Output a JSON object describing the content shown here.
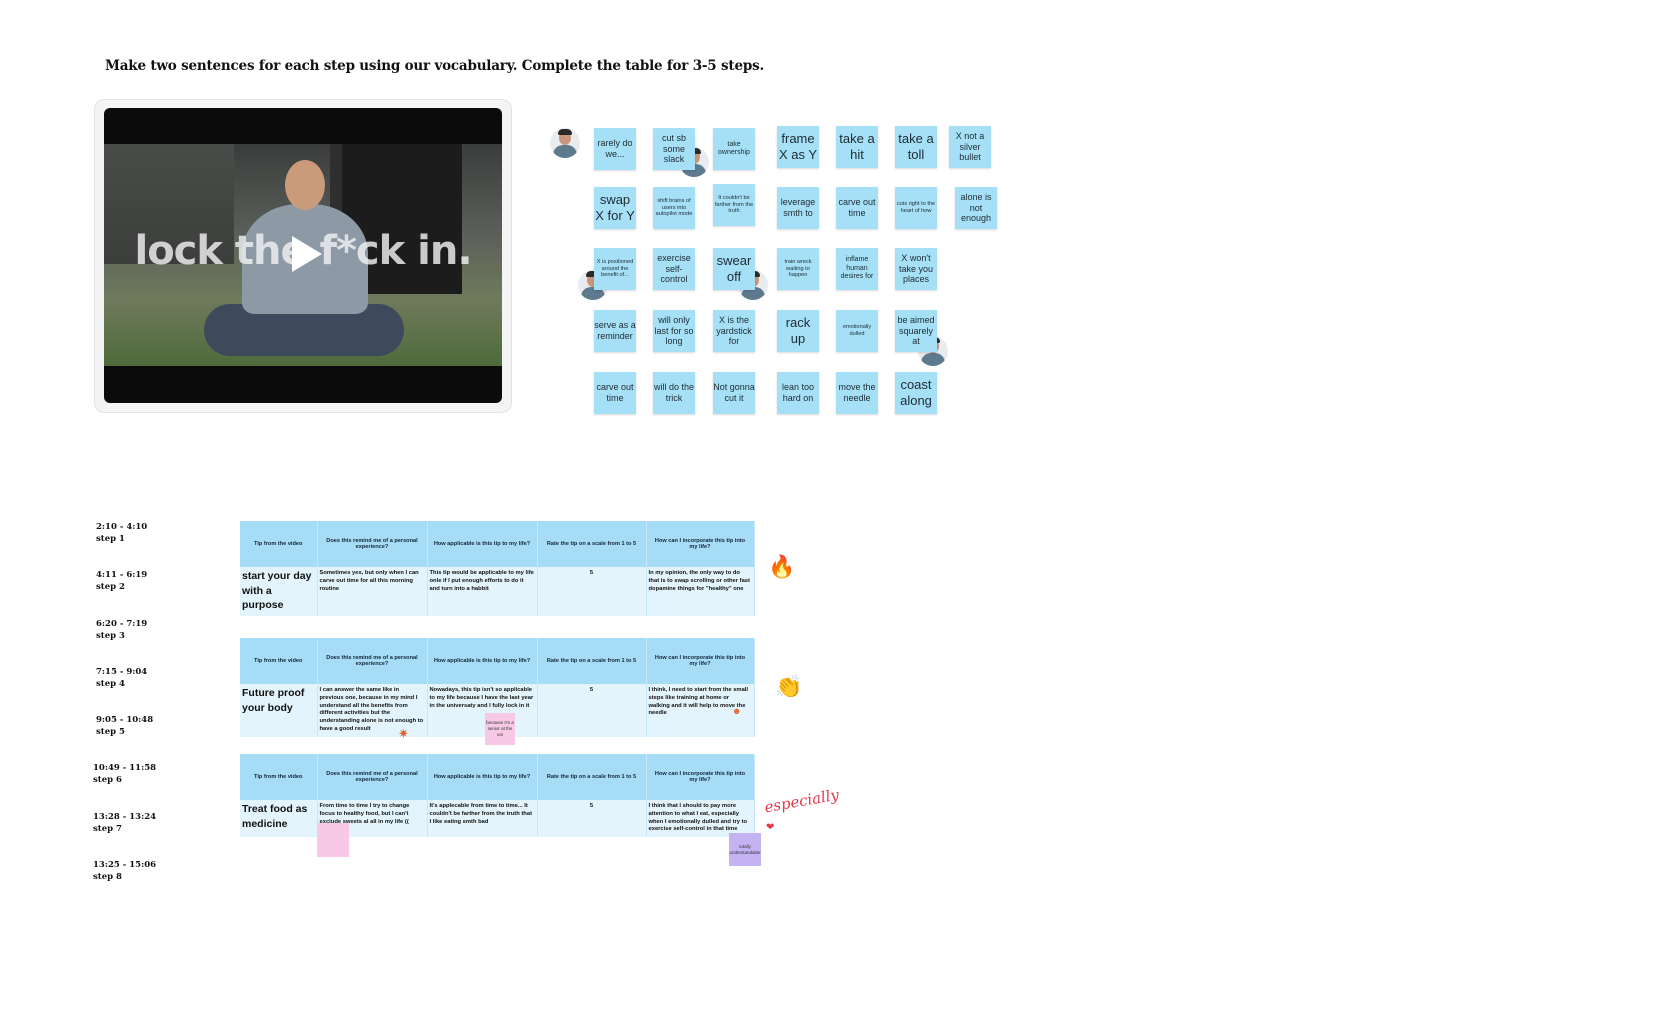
{
  "instruction": "Make two sentences for each step using our vocabulary. Complete the table for 3-5 steps.",
  "video": {
    "overlay_text": "lock th▶f*ck in.",
    "overlay_visible": "lock the f*ck in."
  },
  "stickies": [
    {
      "text": "rarely do we...",
      "size": "m"
    },
    {
      "text": "cut sb some slack",
      "size": "m"
    },
    {
      "text": "take ownership",
      "size": "s"
    },
    {
      "text": "frame X as Y",
      "size": "l"
    },
    {
      "text": "take a hit",
      "size": "l"
    },
    {
      "text": "take a toll",
      "size": "l"
    },
    {
      "text": "X not a silver bullet",
      "size": "m"
    },
    {
      "text": "swap X for Y",
      "size": "l"
    },
    {
      "text": "shift brains of users into autopilot mode",
      "size": "xs"
    },
    {
      "text": "It couldn't be farther from the truth",
      "size": "xs"
    },
    {
      "text": "leverage smth to",
      "size": "m"
    },
    {
      "text": "carve out time",
      "size": "m"
    },
    {
      "text": "cuts right to the heart of how",
      "size": "xs"
    },
    {
      "text": "alone is not enough",
      "size": "m"
    },
    {
      "text": "X is positioned around the benefit of...",
      "size": "xs"
    },
    {
      "text": "exercise self-control",
      "size": "m"
    },
    {
      "text": "swear off",
      "size": "l"
    },
    {
      "text": "train wreck waiting to happen",
      "size": "xs"
    },
    {
      "text": "inflame human desires for",
      "size": "s"
    },
    {
      "text": "X won't take you places",
      "size": "m"
    },
    {
      "text": "serve as a reminder",
      "size": "m"
    },
    {
      "text": "will only last for so long",
      "size": "m"
    },
    {
      "text": "X is the yardstick for",
      "size": "m"
    },
    {
      "text": "rack up",
      "size": "l"
    },
    {
      "text": "emotionally dulled",
      "size": "xs"
    },
    {
      "text": "be aimed squarely at",
      "size": "m"
    },
    {
      "text": "carve out time",
      "size": "m"
    },
    {
      "text": "will do the trick",
      "size": "m"
    },
    {
      "text": "Not gonna cut it",
      "size": "m"
    },
    {
      "text": "lean too hard on",
      "size": "m"
    },
    {
      "text": "move the needle",
      "size": "m"
    },
    {
      "text": "coast along",
      "size": "l"
    }
  ],
  "steps": [
    {
      "time": "2:10 - 4:10",
      "label": "step 1"
    },
    {
      "time": "4:11 - 6:19",
      "label": "step 2"
    },
    {
      "time": "6:20 - 7:19",
      "label": "step 3"
    },
    {
      "time": "7:15 - 9:04",
      "label": "step 4"
    },
    {
      "time": "9:05 - 10:48",
      "label": "step 5"
    },
    {
      "time": "10:49 - 11:58",
      "label": "step 6"
    },
    {
      "time": "13:28 - 13:24",
      "label": "step 7"
    },
    {
      "time": "13:25 - 15:06",
      "label": "step 8"
    }
  ],
  "table_headers": [
    "Tip from the video",
    "Does this remind me of a personal experience?",
    "How applicable is this tip to my life?",
    "Rate the tip on a scale from 1 to 5",
    "How can I incorporate this tip into my life?"
  ],
  "tables": [
    {
      "tip": "start your day with a purpose",
      "experience": "Sometimes yes, but only when I can carve out time for all this morning routine",
      "applicable": "This tip would be applicable to my life onle if I put enough efforts to do it and turn into a habbit",
      "rate": "5",
      "incorporate": "In my opinion, the only way to do that is to swap scrolling or other fast dopamine things for \"healthy\" one",
      "emoji": "🔥"
    },
    {
      "tip": "Future proof your body",
      "experience": "I can answer the same like in previous one, because in my mind I understand all the benefits from different activities but the understanding alone is not enough to have a good result",
      "applicable": "Nowadays, this tip isn't so applicable to my life because I have the last year in the universaty and I fully lock in it",
      "rate": "5",
      "incorporate": "I think, I need to start from the small steps like training at home or walking and it will help to move the needle",
      "emoji": "👏",
      "note": "because I'm a senior at the uni"
    },
    {
      "tip": "Treat food as medicine",
      "experience": "From time to time I try to change focus to healthy food, but I can't exclude sweets al all in my life ((",
      "applicable": "It's applecable from time to time... It couldn't be farther from the truth that I like eating smth bad",
      "rate": "5",
      "incorporate": "I think that I should to pay more attention to what I eat, especially when I emotionally dulled and try to exercise self-control in that time",
      "handwriting": "especially",
      "note": "totally understandable"
    }
  ],
  "colors": {
    "sticky": "#a6e0f7",
    "table_header": "#a6dcf6",
    "table_cell": "#e3f4fc",
    "pink_note": "#f7c9e6",
    "purple_note": "#c3b3f2"
  }
}
